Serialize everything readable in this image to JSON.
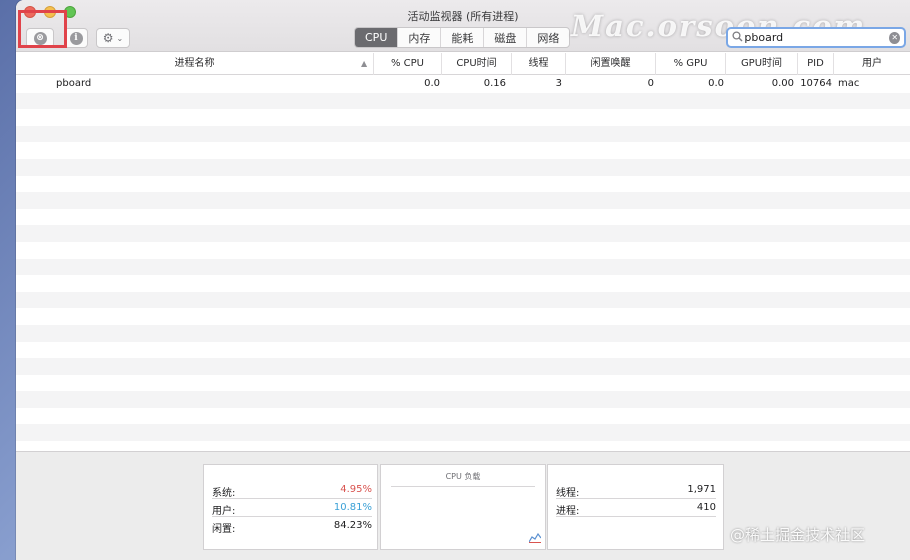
{
  "window": {
    "title": "活动监视器 (所有进程)"
  },
  "toolbar": {
    "stop_icon": "⊗",
    "info_icon": "i",
    "gear_icon": "⚙",
    "chevron_icon": "⌄"
  },
  "tabs": [
    {
      "label": "CPU",
      "active": true
    },
    {
      "label": "内存",
      "active": false
    },
    {
      "label": "能耗",
      "active": false
    },
    {
      "label": "磁盘",
      "active": false
    },
    {
      "label": "网络",
      "active": false
    }
  ],
  "search": {
    "value": "pboard",
    "icon": "magnifying-glass",
    "clear_icon": "✕"
  },
  "watermark": "Mac.orsoon.com",
  "columns": {
    "name": "进程名称",
    "cpu_pct": "% CPU",
    "cpu_time": "CPU时间",
    "threads": "线程",
    "idle_wakeups": "闲置唤醒",
    "gpu_pct": "% GPU",
    "gpu_time": "GPU时间",
    "pid": "PID",
    "user": "用户"
  },
  "rows": [
    {
      "name": "pboard",
      "cpu_pct": "0.0",
      "cpu_time": "0.16",
      "threads": "3",
      "idle_wakeups": "0",
      "gpu_pct": "0.0",
      "gpu_time": "0.00",
      "pid": "10764",
      "user": "mac"
    }
  ],
  "stats_left": {
    "system_label": "系统:",
    "system_value": "4.95%",
    "user_label": "用户:",
    "user_value": "10.81%",
    "idle_label": "闲置:",
    "idle_value": "84.23%"
  },
  "cpu_load": {
    "title": "CPU 负载"
  },
  "stats_right": {
    "threads_label": "线程:",
    "threads_value": "1,971",
    "processes_label": "进程:",
    "processes_value": "410"
  },
  "colors": {
    "system": "#d9534f",
    "user": "#3aa0d6",
    "active_tab": "#6b6b6f",
    "highlight": "#e0434a"
  },
  "source_mark": "@稀土掘金技术社区"
}
